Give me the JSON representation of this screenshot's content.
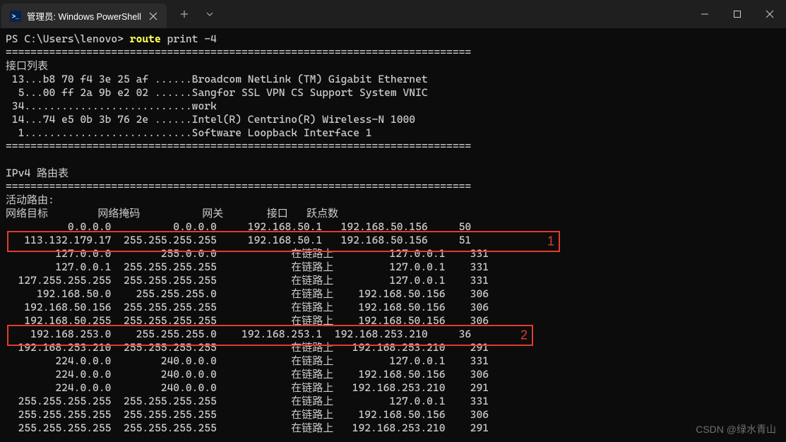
{
  "window": {
    "tab_title": "管理员: Windows PowerShell",
    "new_tab_tooltip": "+",
    "dropdown_tooltip": "˅"
  },
  "prompt": {
    "prefix": "PS C:\\Users\\lenovo> ",
    "command_highlight": "route",
    "command_rest": " print -4"
  },
  "divider": "===========================================================================",
  "interface_list": {
    "header": "接口列表",
    "rows": [
      " 13...b8 70 f4 3e 25 af ......Broadcom NetLink (TM) Gigabit Ethernet",
      "  5...00 ff 2a 9b e2 02 ......Sangfor SSL VPN CS Support System VNIC",
      " 34...........................work",
      " 14...74 e5 0b 3b 76 2e ......Intel(R) Centrino(R) Wireless-N 1000",
      "  1...........................Software Loopback Interface 1"
    ]
  },
  "route_table": {
    "title": "IPv4 路由表",
    "active_routes_label": "活动路由:",
    "columns_line": "网络目标        网络掩码          网关       接口   跃点数",
    "rows": [
      "          0.0.0.0          0.0.0.0     192.168.50.1   192.168.50.156     50",
      "   113.132.179.17  255.255.255.255     192.168.50.1   192.168.50.156     51",
      "        127.0.0.0        255.0.0.0            在链路上         127.0.0.1    331",
      "        127.0.0.1  255.255.255.255            在链路上         127.0.0.1    331",
      "  127.255.255.255  255.255.255.255            在链路上         127.0.0.1    331",
      "     192.168.50.0    255.255.255.0            在链路上    192.168.50.156    306",
      "   192.168.50.156  255.255.255.255            在链路上    192.168.50.156    306",
      "   192.168.50.255  255.255.255.255            在链路上    192.168.50.156    306",
      "    192.168.253.0    255.255.255.0    192.168.253.1  192.168.253.210     36",
      "  192.168.253.210  255.255.255.255            在链路上   192.168.253.210    291",
      "        224.0.0.0        240.0.0.0            在链路上         127.0.0.1    331",
      "        224.0.0.0        240.0.0.0            在链路上    192.168.50.156    306",
      "        224.0.0.0        240.0.0.0            在链路上   192.168.253.210    291",
      "  255.255.255.255  255.255.255.255            在链路上         127.0.0.1    331",
      "  255.255.255.255  255.255.255.255            在链路上    192.168.50.156    306",
      "  255.255.255.255  255.255.255.255            在链路上   192.168.253.210    291"
    ]
  },
  "annotations": {
    "box1_label": "1",
    "box2_label": "2"
  },
  "watermark": "CSDN @绿水青山"
}
